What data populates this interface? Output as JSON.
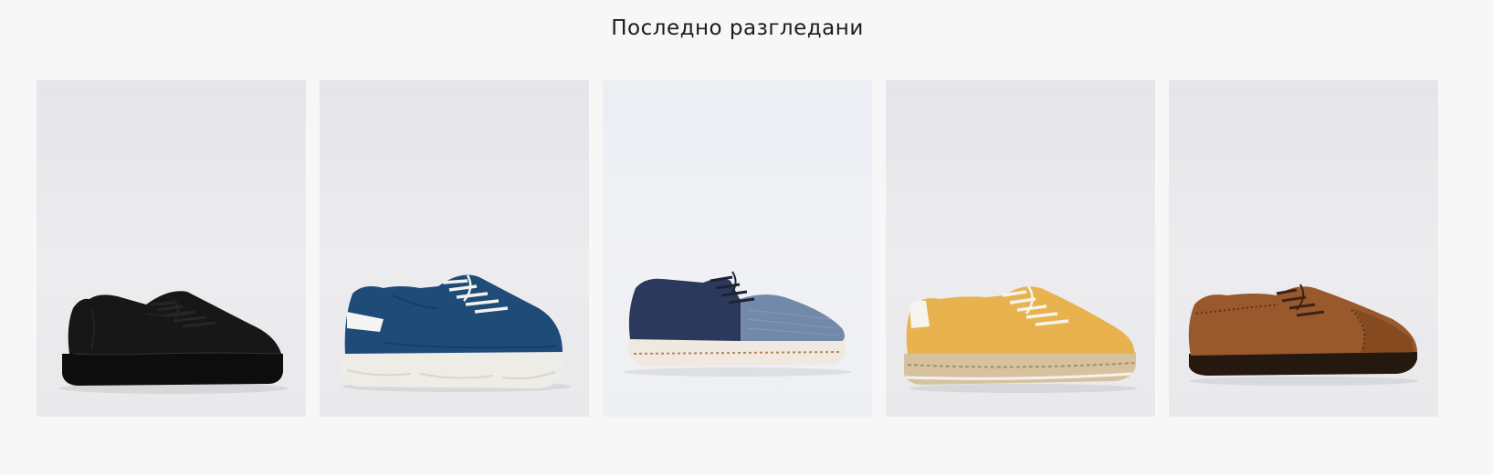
{
  "section": {
    "title": "Последно разгледани"
  },
  "products": [
    {
      "name": "black-leather-sneaker",
      "colors": {
        "upper": "#141414",
        "sole": "#0c0c0c",
        "laces": "#1a1a1a"
      }
    },
    {
      "name": "blue-leather-sneaker",
      "colors": {
        "upper": "#1f4e7a",
        "sole": "#ecebe6",
        "laces": "#f2f2ee"
      }
    },
    {
      "name": "blue-suede-linen-derby",
      "colors": {
        "upper": "#6f87a8",
        "toe": "#2b3a5c",
        "sole": "#f1ebe2",
        "laces": "#2a2a3a"
      }
    },
    {
      "name": "yellow-espadrille-sneaker",
      "colors": {
        "upper": "#e9b552",
        "sole": "#d8c4a2",
        "laces": "#f4f1ea"
      }
    },
    {
      "name": "brown-suede-brogue",
      "colors": {
        "upper": "#9a5a2e",
        "sole": "#2a1c14",
        "laces": "#3a2418"
      }
    }
  ]
}
